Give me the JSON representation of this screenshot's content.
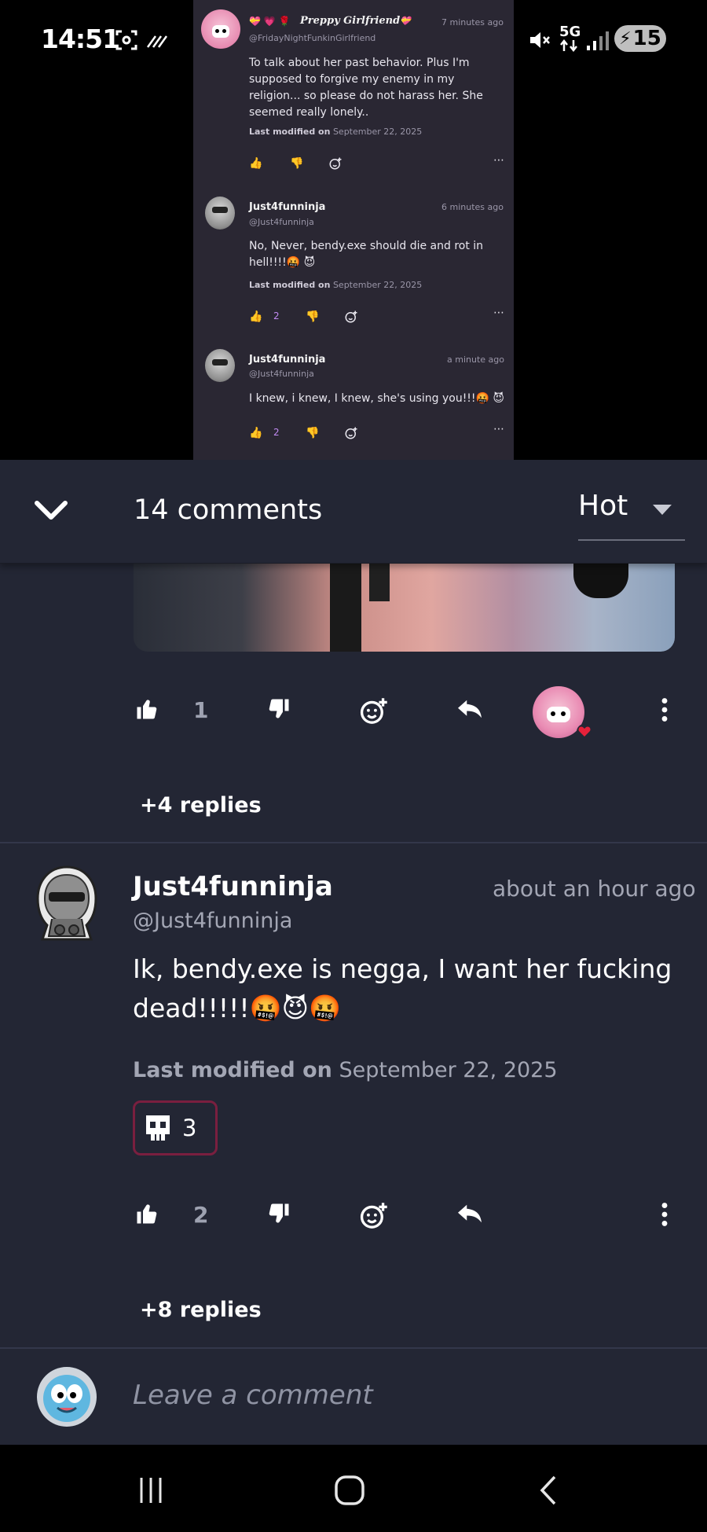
{
  "status_bar": {
    "time": "14:51",
    "network": "5G",
    "battery": "15",
    "icons": [
      "screenshot-icon",
      "nfc-icon",
      "mute-icon",
      "signal-icon",
      "battery-charging-icon"
    ]
  },
  "embedded_screenshot": {
    "comments": [
      {
        "badges": "💝 💗 🌹",
        "name": "Preppy Girlfriend",
        "name_emoji": "💝",
        "handle": "@FridayNightFunkinGirlfriend",
        "time": "7 minutes ago",
        "body": "To talk about her past behavior. Plus I'm supposed to forgive my enemy in my religion... so please do not harass her. She seemed really lonely..",
        "modified_label": "Last modified on",
        "modified_date": "September 22, 2025",
        "likes": ""
      },
      {
        "name": "Just4funninja",
        "handle": "@Just4funninja",
        "time": "6 minutes ago",
        "body": "No, Never, bendy.exe should die and rot in hell!!!!🤬 😈",
        "modified_label": "Last modified on",
        "modified_date": "September 22, 2025",
        "likes": "2"
      },
      {
        "name": "Just4funninja",
        "handle": "@Just4funninja",
        "time": "a minute ago",
        "body": "I knew, i knew, I knew, she's using you!!!🤬 😈",
        "likes": "2"
      }
    ],
    "more_icon": "⋯"
  },
  "sheet": {
    "header": {
      "count_label": "14 comments",
      "sort_value": "Hot"
    },
    "first_comment_actions": {
      "likes": "1"
    },
    "first_comment_replies": "+4 replies",
    "comment": {
      "name": "Just4funninja",
      "handle": "@Just4funninja",
      "time": "about an hour ago",
      "body": "Ik, bendy.exe is negga, I want her fucking dead!!!!!🤬😈🤬",
      "modified_label": "Last modified on",
      "modified_date": "September 22, 2025",
      "reaction_count": "3",
      "likes": "2",
      "replies": "+8 replies"
    },
    "composer": {
      "placeholder": "Leave a comment"
    }
  },
  "colors": {
    "sheet_bg": "#232634",
    "accent_like": "#c18af2",
    "reaction_border": "#7a1f3f"
  }
}
